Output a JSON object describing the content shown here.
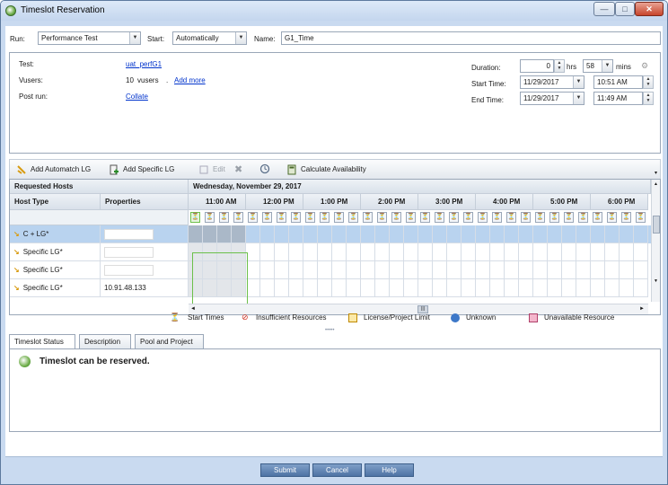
{
  "window": {
    "title": "Timeslot Reservation",
    "minimize": "—",
    "maximize": "□",
    "close": "✕"
  },
  "form": {
    "run_label": "Run:",
    "run_value": "Performance Test",
    "start_label": "Start:",
    "start_value": "Automatically",
    "name_label": "Name:",
    "name_value": "G1_Time"
  },
  "info": {
    "test_label": "Test:",
    "test_value": "uat_perfG1",
    "vusers_label": "Vusers:",
    "vusers_count": "10",
    "vusers_unit": "vusers",
    "vusers_sep": ".",
    "add_more": "Add more",
    "postrun_label": "Post run:",
    "postrun_value": "Collate",
    "duration_label": "Duration:",
    "duration_hrs": "0",
    "hrs_label": "hrs",
    "duration_mins": "58",
    "mins_label": "mins",
    "start_time_label": "Start Time:",
    "start_date": "11/29/2017",
    "start_time": "10:51 AM",
    "end_time_label": "End Time:",
    "end_date": "11/29/2017",
    "end_time": "11:49 AM"
  },
  "toolbar": {
    "add_automatch": "Add Automatch LG",
    "add_specific": "Add Specific LG",
    "edit": "Edit",
    "calculate": "Calculate Availability"
  },
  "grid": {
    "requested_hosts": "Requested Hosts",
    "date_header": "Wednesday, November 29, 2017",
    "col_host_type": "Host Type",
    "col_properties": "Properties",
    "hours": [
      "11:00 AM",
      "12:00 PM",
      "1:00 PM",
      "2:00 PM",
      "3:00 PM",
      "4:00 PM",
      "5:00 PM",
      "6:00 PM"
    ],
    "rows": [
      {
        "type": "C + LG*",
        "props": ""
      },
      {
        "type": "Specific LG*",
        "props": ""
      },
      {
        "type": "Specific LG*",
        "props": ""
      },
      {
        "type": "Specific LG*",
        "props": "10.91.48.133"
      }
    ]
  },
  "legend": {
    "start_times": "Start Times",
    "insufficient": "Insufficient Resources",
    "license": "License/Project Limit",
    "unknown": "Unknown",
    "unavailable": "Unavailable Resource"
  },
  "tabs": [
    "Timeslot Status",
    "Description",
    "Pool and Project"
  ],
  "status": {
    "message": "Timeslot can be reserved."
  },
  "buttons": {
    "submit": "Submit",
    "cancel": "Cancel",
    "help": "Help"
  },
  "colors": {
    "selected_row": "#b9d3ef",
    "slot_border": "#6cc04a",
    "button_blue": "#5a7fb0"
  }
}
